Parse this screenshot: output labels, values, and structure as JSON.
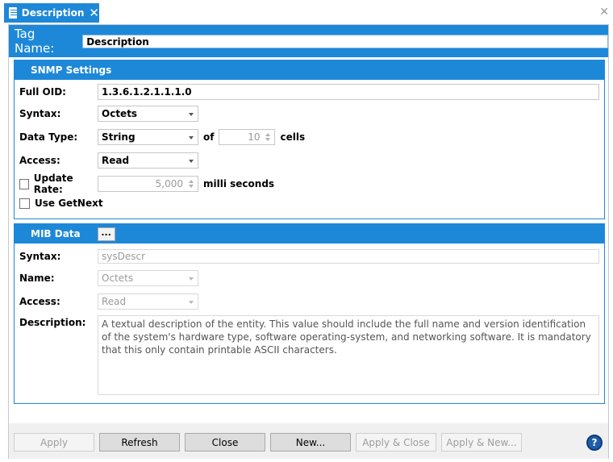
{
  "tab": {
    "title": "Description"
  },
  "tag": {
    "label": "Tag Name:",
    "value": "Description"
  },
  "snmp": {
    "header": "SNMP Settings",
    "full_oid": {
      "label": "Full OID:",
      "value": "1.3.6.1.2.1.1.1.0"
    },
    "syntax": {
      "label": "Syntax:",
      "value": "Octets"
    },
    "data_type": {
      "label": "Data Type:",
      "value": "String",
      "of_label": "of",
      "cells_value": "10",
      "cells_label": "cells"
    },
    "access": {
      "label": "Access:",
      "value": "Read"
    },
    "update_rate": {
      "label": "Update Rate:",
      "value": "5,000",
      "unit": "milli seconds",
      "checked": false
    },
    "use_getnext": {
      "label": "Use GetNext",
      "checked": false
    }
  },
  "mib": {
    "header": "MIB Data",
    "more_label": "...",
    "syntax": {
      "label": "Syntax:",
      "value": "sysDescr"
    },
    "name": {
      "label": "Name:",
      "value": "Octets"
    },
    "access": {
      "label": "Access:",
      "value": "Read"
    },
    "description": {
      "label": "Description:",
      "value": "A textual description of the entity. This value should include the full name and version identification of the system's hardware type, software operating-system, and networking software. It is mandatory that this only contain printable ASCII characters."
    }
  },
  "footer": {
    "apply": "Apply",
    "refresh": "Refresh",
    "close": "Close",
    "new": "New...",
    "apply_close": "Apply & Close",
    "apply_new": "Apply & New...",
    "help": "?"
  },
  "icons": [
    "document-icon",
    "close-icon",
    "window-close-icon",
    "chevron-down-icon",
    "spinner-up-icon",
    "spinner-down-icon",
    "help-icon"
  ],
  "colors": {
    "accent": "#1e88d8",
    "help": "#1e5ea8"
  }
}
